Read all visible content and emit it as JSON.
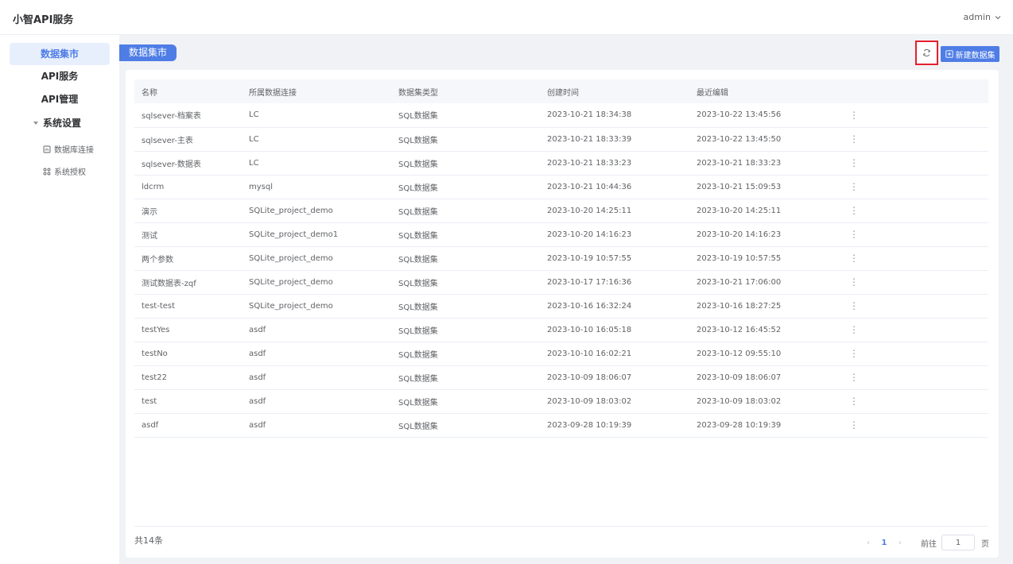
{
  "app": {
    "title": "小智API服务",
    "user": "admin"
  },
  "sidebar": {
    "items": [
      {
        "label": "数据集市"
      },
      {
        "label": "API服务"
      },
      {
        "label": "API管理"
      }
    ],
    "group": {
      "label": "系统设置"
    },
    "sub_items": [
      {
        "label": "数据库连接",
        "icon": "database-icon"
      },
      {
        "label": "系统授权",
        "icon": "authorization-icon"
      }
    ]
  },
  "main": {
    "tag": "数据集市",
    "new_button": "新建数据集",
    "refresh_icon": "refresh-icon"
  },
  "table": {
    "columns": [
      "名称",
      "所属数据连接",
      "数据集类型",
      "创建时间",
      "最近编辑"
    ],
    "rows": [
      [
        "sqlsever-档案表",
        "LC",
        "SQL数据集",
        "2023-10-21 18:34:38",
        "2023-10-22 13:45:56"
      ],
      [
        "sqlsever-主表",
        "LC",
        "SQL数据集",
        "2023-10-21 18:33:39",
        "2023-10-22 13:45:50"
      ],
      [
        "sqlsever-数据表",
        "LC",
        "SQL数据集",
        "2023-10-21 18:33:23",
        "2023-10-21 18:33:23"
      ],
      [
        "ldcrm",
        "mysql",
        "SQL数据集",
        "2023-10-21 10:44:36",
        "2023-10-21 15:09:53"
      ],
      [
        "演示",
        "SQLite_project_demo",
        "SQL数据集",
        "2023-10-20 14:25:11",
        "2023-10-20 14:25:11"
      ],
      [
        "测试",
        "SQLite_project_demo1",
        "SQL数据集",
        "2023-10-20 14:16:23",
        "2023-10-20 14:16:23"
      ],
      [
        "两个参数",
        "SQLite_project_demo",
        "SQL数据集",
        "2023-10-19 10:57:55",
        "2023-10-19 10:57:55"
      ],
      [
        "测试数据表-zqf",
        "SQLite_project_demo",
        "SQL数据集",
        "2023-10-17 17:16:36",
        "2023-10-21 17:06:00"
      ],
      [
        "test-test",
        "SQLite_project_demo",
        "SQL数据集",
        "2023-10-16 16:32:24",
        "2023-10-16 18:27:25"
      ],
      [
        "testYes",
        "asdf",
        "SQL数据集",
        "2023-10-10 16:05:18",
        "2023-10-12 16:45:52"
      ],
      [
        "testNo",
        "asdf",
        "SQL数据集",
        "2023-10-10 16:02:21",
        "2023-10-12 09:55:10"
      ],
      [
        "test22",
        "asdf",
        "SQL数据集",
        "2023-10-09 18:06:07",
        "2023-10-09 18:06:07"
      ],
      [
        "test",
        "asdf",
        "SQL数据集",
        "2023-10-09 18:03:02",
        "2023-10-09 18:03:02"
      ],
      [
        "asdf",
        "asdf",
        "SQL数据集",
        "2023-09-28 10:19:39",
        "2023-09-28 10:19:39"
      ]
    ],
    "row_action": "⋮"
  },
  "footer": {
    "total": "共14条",
    "current_page": "1",
    "goto_label": "前往",
    "goto_value": "1",
    "goto_unit": "页"
  },
  "colors": {
    "accent": "#4f7de6",
    "highlight": "#e5202e"
  }
}
